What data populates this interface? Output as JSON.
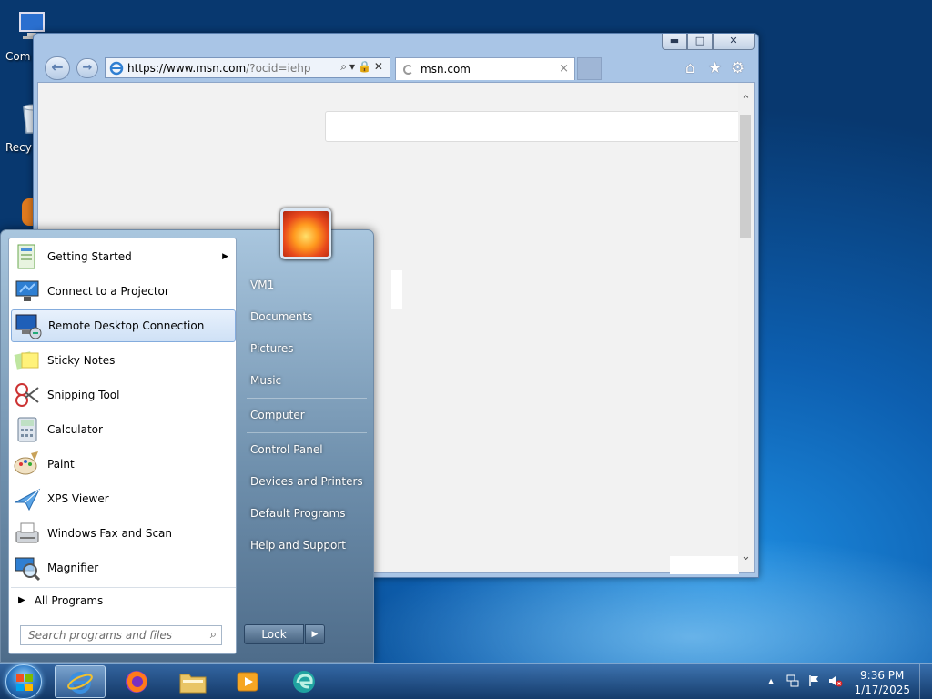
{
  "desktop": {
    "icons": [
      {
        "label": "Com",
        "icon": "computer-icon"
      },
      {
        "label": "Recy",
        "icon": "recycle-bin-icon"
      }
    ]
  },
  "browser": {
    "window_buttons": {
      "minimize": "▬",
      "maximize": "□",
      "close": "✕"
    },
    "nav": {
      "back": "←",
      "forward": "→"
    },
    "address": {
      "host": "https://www.msn.com",
      "rest": "/?ocid=iehp",
      "tools": "⌕▾🔒✕"
    },
    "tab": {
      "title": "msn.com",
      "close": "×"
    },
    "toolbar_icons": {
      "home": "⌂",
      "favorites": "★",
      "settings": "⚙"
    }
  },
  "start_menu": {
    "programs": [
      {
        "label": "Getting Started",
        "icon": "getting-started-icon",
        "has_submenu": true
      },
      {
        "label": "Connect to a Projector",
        "icon": "projector-icon"
      },
      {
        "label": "Remote Desktop Connection",
        "icon": "remote-desktop-icon",
        "selected": true
      },
      {
        "label": "Sticky Notes",
        "icon": "sticky-notes-icon"
      },
      {
        "label": "Snipping Tool",
        "icon": "snipping-tool-icon"
      },
      {
        "label": "Calculator",
        "icon": "calculator-icon"
      },
      {
        "label": "Paint",
        "icon": "paint-icon"
      },
      {
        "label": "XPS Viewer",
        "icon": "xps-viewer-icon"
      },
      {
        "label": "Windows Fax and Scan",
        "icon": "fax-scan-icon"
      },
      {
        "label": "Magnifier",
        "icon": "magnifier-icon"
      }
    ],
    "all_programs": "All Programs",
    "search_placeholder": "Search programs and files",
    "right_links": [
      "VM1",
      "Documents",
      "Pictures",
      "Music",
      "Computer",
      "Control Panel",
      "Devices and Printers",
      "Default Programs",
      "Help and Support"
    ],
    "lock_label": "Lock",
    "lock_arrow": "▶"
  },
  "taskbar": {
    "apps": [
      "internet-explorer-icon",
      "firefox-icon",
      "file-explorer-icon",
      "media-player-icon",
      "edge-icon"
    ],
    "tray": {
      "chevron": "▲"
    },
    "clock": {
      "time": "9:36 PM",
      "date": "1/17/2025"
    }
  },
  "colors": {
    "accent": "#1d8ce0",
    "selection": "#cfe1f6"
  }
}
